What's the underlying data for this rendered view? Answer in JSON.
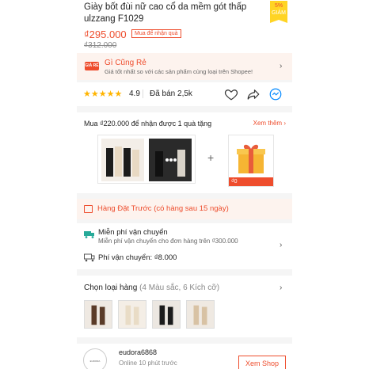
{
  "product": {
    "title": "Giày bốt đùi nữ cao cổ da mềm gót thấp ulzzang F1029",
    "discount_percent": "5%",
    "discount_label": "GIẢM",
    "price": "₫295.000",
    "price_tag": "Mua để nhận quà",
    "old_price": "₫312.000"
  },
  "cheap_banner": {
    "icon_text": "GIÁ RẺ",
    "title": "Gì Cũng Rẻ",
    "subtitle": "Giá tốt nhất so với các sản phẩm cùng loại trên Shopee!"
  },
  "rating": {
    "stars": "★★★★★",
    "value": "4.9",
    "sold": "Đã bán 2,5k",
    "icons": [
      "heart-icon",
      "share-icon",
      "chat-icon"
    ]
  },
  "gift": {
    "heading": "Mua ₫220.000 để nhận được 1 quà tặng",
    "see_more": "Xem thêm",
    "plus": "+",
    "gift_price": "₫0"
  },
  "preorder": {
    "text": "Hàng Đặt Trước (có hàng sau 15 ngày)"
  },
  "shipping": {
    "title": "Miễn phí vận chuyển",
    "subtitle": "Miễn phí vận chuyển cho đơn hàng trên ₫300.000",
    "fee": "Phí vận chuyển: ₫8.000"
  },
  "variants": {
    "title": "Chọn loại hàng",
    "detail": "(4 Màu sắc, 6 Kích cỡ)"
  },
  "shop": {
    "avatar_text": "EUDORA",
    "name": "eudora6868",
    "status": "Online 10 phút trước",
    "button": "Xem Shop"
  },
  "colors": {
    "accent": "#ee4d2d",
    "star": "#ffb400",
    "banner_bg": "#fdf3ee"
  }
}
